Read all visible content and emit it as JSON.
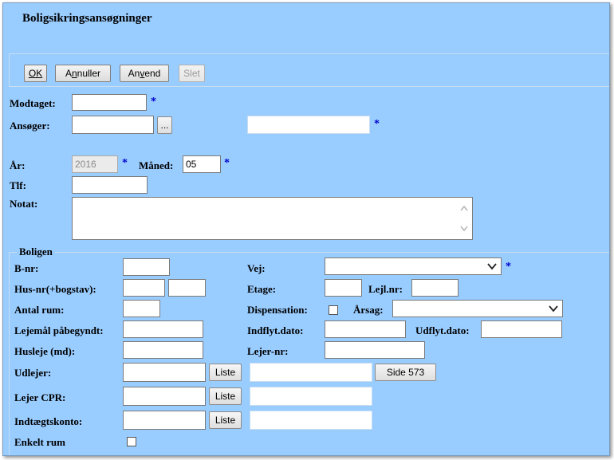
{
  "title": "Boligsikringsansøgninger",
  "toolbar": {
    "ok": "OK",
    "annuller_pre": "A",
    "annuller_u": "n",
    "annuller_post": "nuller",
    "anvend_pre": "An",
    "anvend_u": "v",
    "anvend_post": "end",
    "slet": "Slet"
  },
  "form": {
    "modtaget_label": "Modtaget:",
    "modtaget_value": "",
    "ansoger_label": "Ansøger:",
    "ansoger_value": "",
    "ansoger_browse": "...",
    "ansoger_name": "",
    "ar_label": "År:",
    "ar_value": "2016",
    "maned_label": "Måned:",
    "maned_value": "05",
    "tlf_label": "Tlf:",
    "tlf_value": "",
    "notat_label": "Notat:",
    "notat_value": "",
    "required_mark": "*"
  },
  "boligen": {
    "legend": "Boligen",
    "bnr_label": "B-nr:",
    "husnr_label": "Hus-nr(+bogstav):",
    "antal_rum_label": "Antal rum:",
    "lejemaal_label": "Lejemål påbegyndt:",
    "husleje_label": "Husleje (md):",
    "udlejer_label": "Udlejer:",
    "lejer_cpr_label": "Lejer CPR:",
    "indtaegt_label": "Indtægtskonto:",
    "enkelt_rum_label": "Enkelt rum",
    "vej_label": "Vej:",
    "etage_label": "Etage:",
    "lejlnr_label": "Lejl.nr:",
    "dispensation_label": "Dispensation:",
    "aarsag_label": "Årsag:",
    "indflyt_label": "Indflyt.dato:",
    "udflyt_label": "Udflyt.dato:",
    "lejernr_label": "Lejer-nr:",
    "liste_label": "Liste",
    "side_label": "Side 573"
  }
}
